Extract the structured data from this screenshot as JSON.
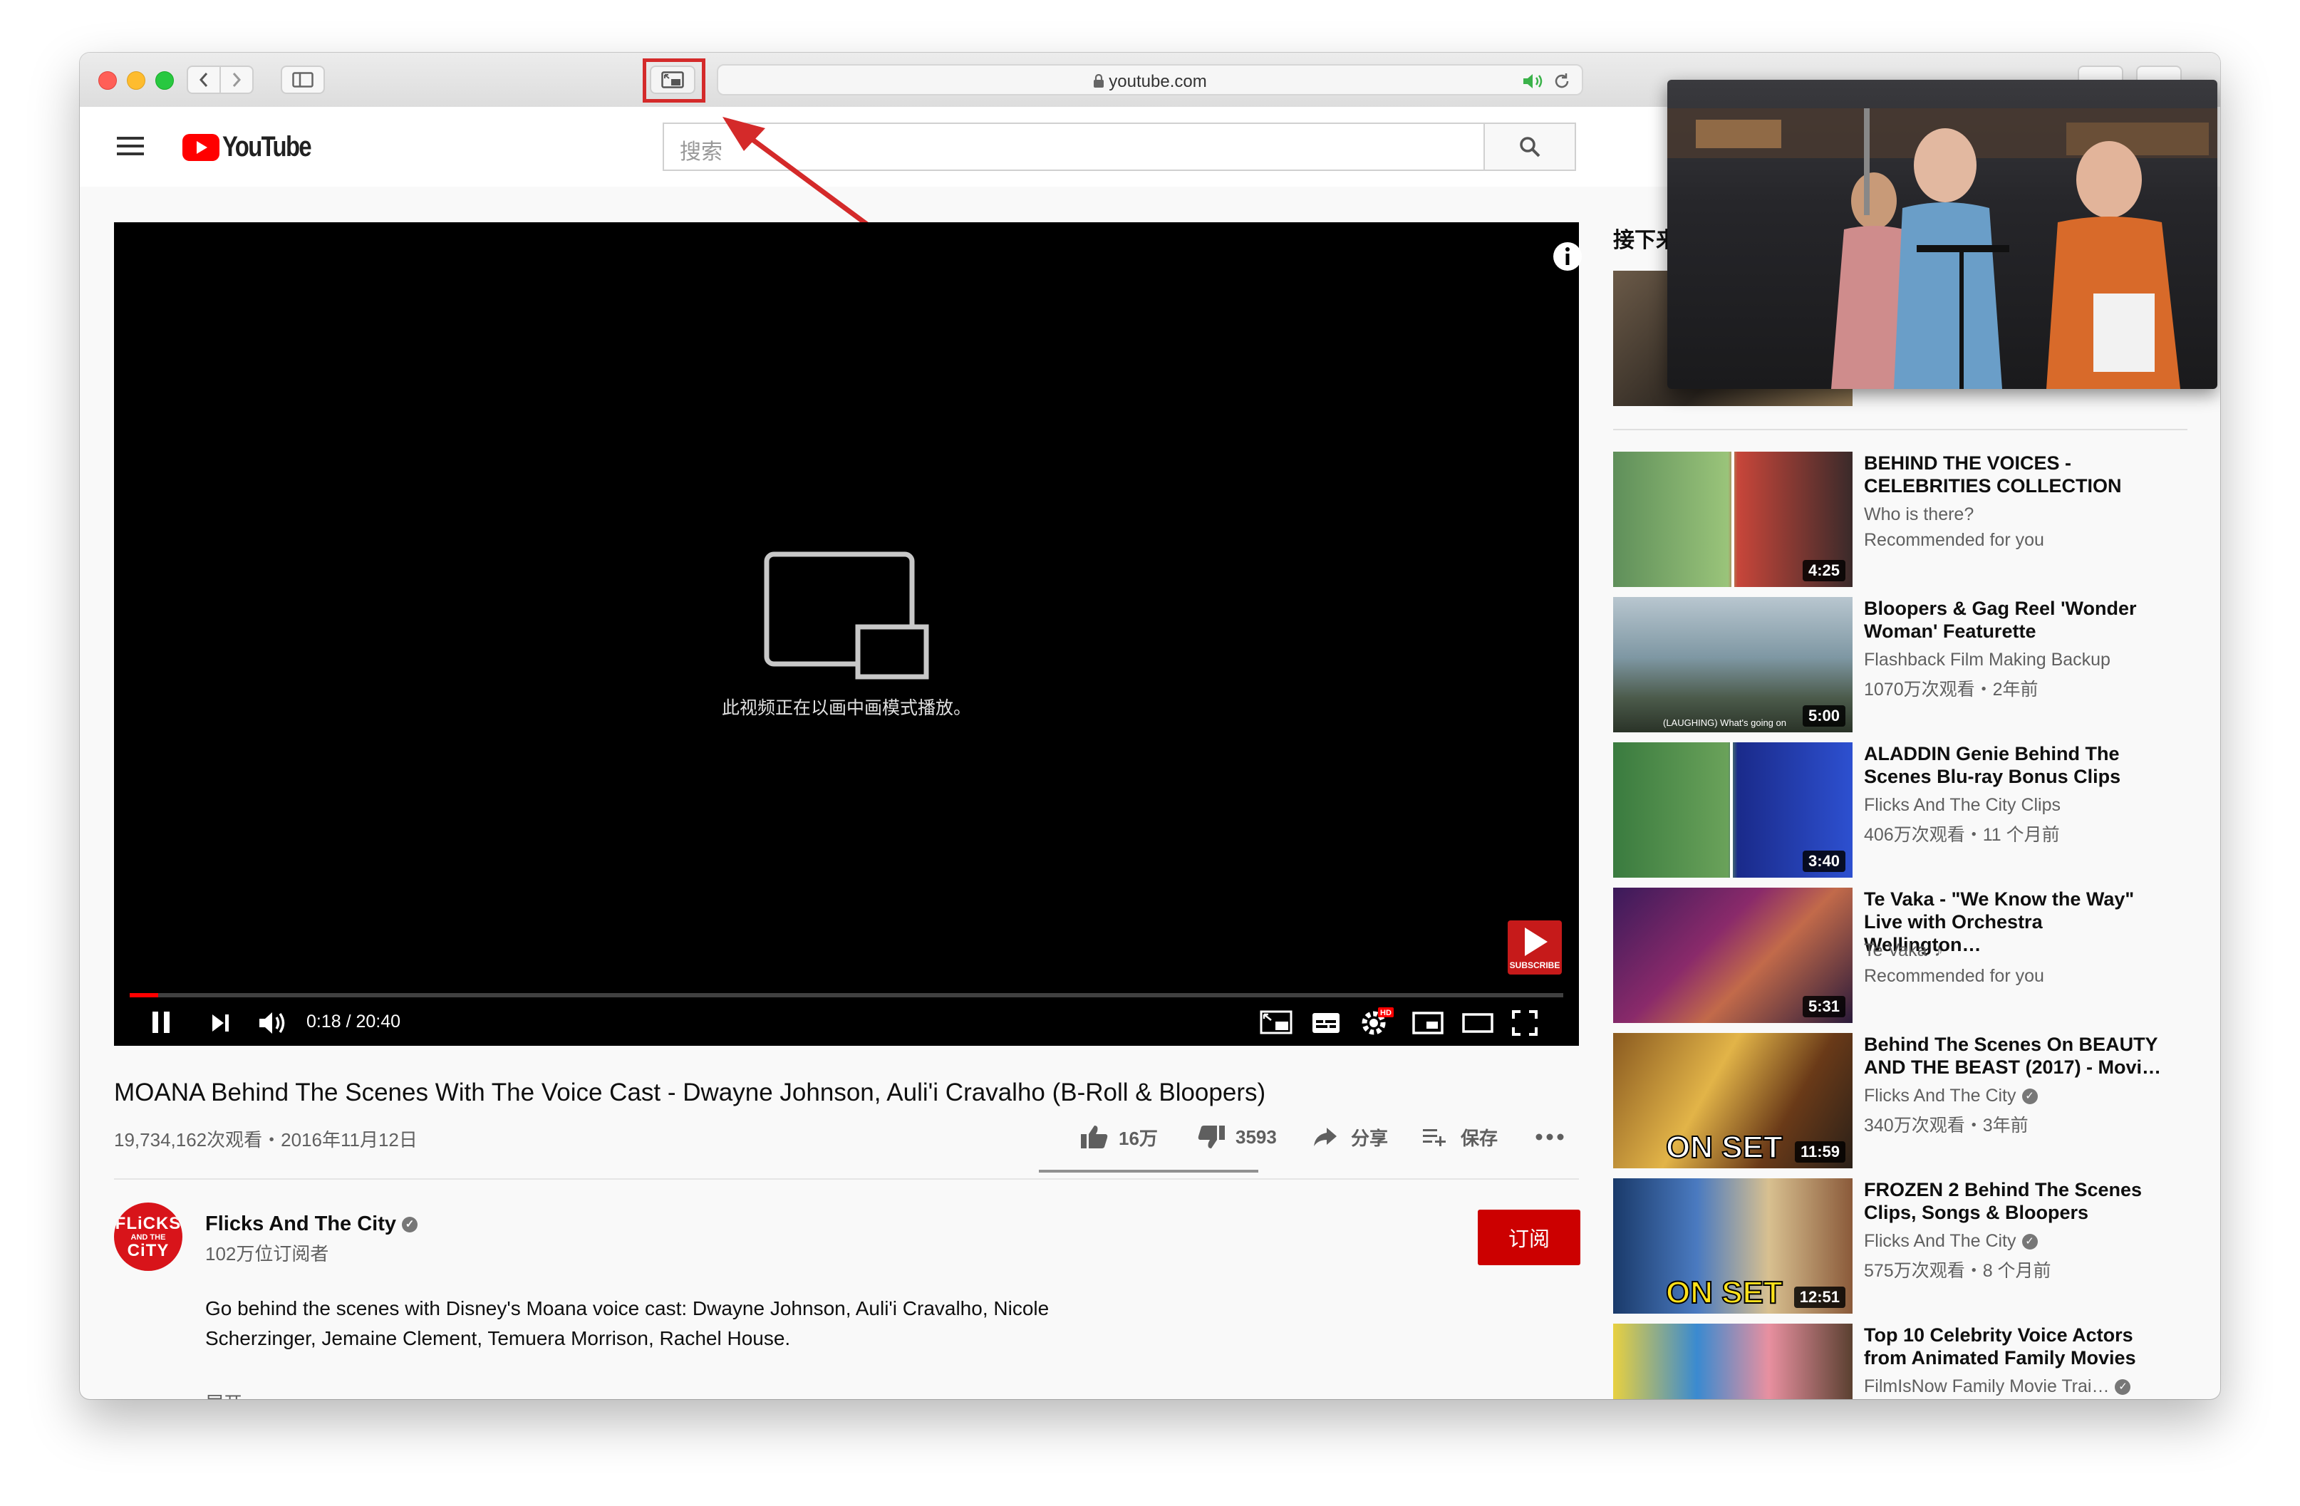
{
  "browser": {
    "address": "youtube.com"
  },
  "yt": {
    "logo_text": "YouTube",
    "search_placeholder": "搜索"
  },
  "player": {
    "pip_message": "此视频正在以画中画模式播放。",
    "time": "0:18 / 20:40",
    "progress": 0.014,
    "subscribe_badge": "SUBSCRIBE",
    "hd_badge": "HD"
  },
  "video": {
    "title": "MOANA Behind The Scenes With The Voice Cast - Dwayne Johnson, Auli'i Cravalho (B-Roll & Bloopers)",
    "stats": "19,734,162次观看・2016年11月12日",
    "likes": "16万",
    "dislikes": "3593",
    "share": "分享",
    "save": "保存"
  },
  "channel": {
    "logo_line1": "FLiCKS",
    "logo_line2": "AND THE",
    "logo_line3": "CiTY",
    "name": "Flicks And The City",
    "subscribers": "102万位订阅者",
    "subscribe_label": "订阅",
    "description_line1": "Go behind the scenes with Disney's Moana voice cast: Dwayne Johnson, Auli'i Cravalho, Nicole",
    "description_line2": "Scherzinger, Jemaine Clement, Temuera Morrison, Rachel House.",
    "show_more": "展开"
  },
  "sidebar": {
    "up_next": "接下来",
    "items": [
      {
        "title": "BEHIND THE VOICES -\nCELEBRITIES COLLECTION",
        "channel": "Who is there?",
        "meta": "Recommended for you",
        "duration": "4:25"
      },
      {
        "title": "Bloopers & Gag Reel 'Wonder\nWoman' Featurette",
        "channel": "Flashback Film Making Backup",
        "meta": "1070万次观看・2年前",
        "duration": "5:00",
        "caption": "(LAUGHING) What's going on"
      },
      {
        "title": "ALADDIN Genie Behind The\nScenes Blu-ray Bonus Clips",
        "channel": "Flicks And The City Clips",
        "meta": "406万次观看・11 个月前",
        "duration": "3:40"
      },
      {
        "title": "Te Vaka - \"We Know the Way\"\nLive with Orchestra Wellington…",
        "channel": "Te Vaka",
        "meta": "Recommended for you",
        "duration": "5:31"
      },
      {
        "title": "Behind The Scenes On BEAUTY\nAND THE BEAST (2017) - Movi…",
        "channel": "Flicks And The City",
        "meta": "340万次观看・3年前",
        "duration": "11:59",
        "overlay": "ON SET"
      },
      {
        "title": "FROZEN 2 Behind The Scenes\nClips, Songs & Bloopers",
        "channel": "Flicks And The City",
        "meta": "575万次观看・8 个月前",
        "duration": "12:51",
        "overlay": "ON SET"
      },
      {
        "title": "Top 10 Celebrity Voice Actors\nfrom Animated Family Movies",
        "channel": "FilmIsNow Family Movie Trai…",
        "meta": "",
        "duration": ""
      }
    ]
  },
  "colors": {
    "youtube_red": "#ff0000",
    "subscribe_red": "#cc0000",
    "annotation_red": "#d42a2a",
    "mac_red": "#ff5f57",
    "mac_yellow": "#febc2e",
    "mac_green": "#28c840"
  }
}
